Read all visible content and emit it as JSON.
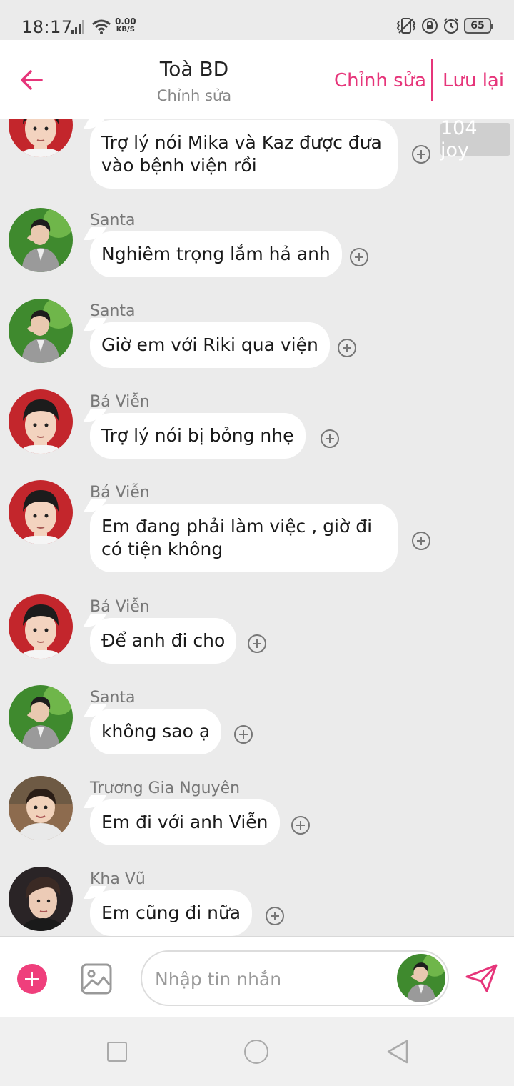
{
  "status_bar": {
    "time": "18:17",
    "net_speed_value": "0.00",
    "net_speed_unit": "KB/S",
    "battery": "65"
  },
  "header": {
    "title": "Toà BD",
    "subtitle": "Chỉnh sửa",
    "edit_label": "Chỉnh sửa",
    "save_label": "Lưu lại"
  },
  "messages": [
    {
      "sender": "",
      "text": "Trợ lý nói Mika và Kaz được đưa vào bệnh viện rồi",
      "avatar": "boy-red-bg"
    },
    {
      "sender": "Santa",
      "text": "Nghiêm trọng lắm hả anh",
      "avatar": "man-suit-green-bg"
    },
    {
      "sender": "Santa",
      "text": "Giờ em với Riki qua viện",
      "avatar": "man-suit-green-bg"
    },
    {
      "sender": "Bá Viễn",
      "text": "Trợ lý nói bị bỏng nhẹ",
      "avatar": "boy-red-bg"
    },
    {
      "sender": "Bá Viễn",
      "text": "Em đang phải làm việc , giờ đi có tiện không",
      "avatar": "boy-red-bg"
    },
    {
      "sender": "Bá Viễn",
      "text": "Để anh đi cho",
      "avatar": "boy-red-bg"
    },
    {
      "sender": "Santa",
      "text": "không sao ạ",
      "avatar": "man-suit-green-bg"
    },
    {
      "sender": "Trương Gia Nguyên",
      "text": "Em đi với anh Viễn",
      "avatar": "child-outdoor"
    },
    {
      "sender": "Kha Vũ",
      "text": "Em cũng đi nữa",
      "avatar": "young-man-dark"
    }
  ],
  "badge": {
    "text": "104 joy"
  },
  "input": {
    "placeholder": "Nhập tin nhắn",
    "value": ""
  },
  "colors": {
    "accent": "#e6357a",
    "background": "#ebebeb",
    "bubble": "#ffffff"
  }
}
